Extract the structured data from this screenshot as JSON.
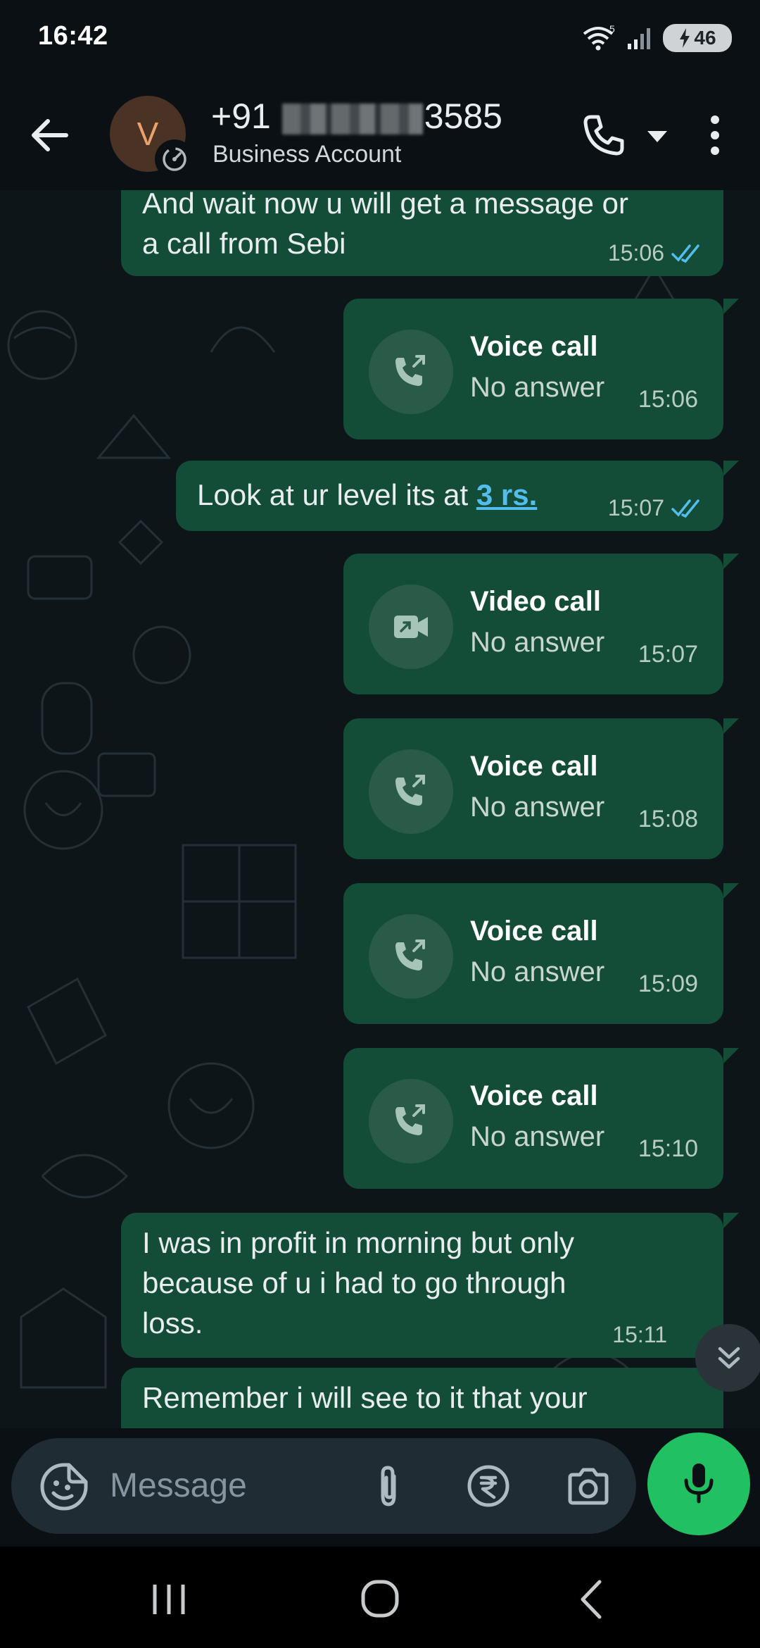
{
  "status_bar": {
    "time": "16:42",
    "wifi_badge": "5",
    "battery": "46",
    "icons": [
      "wifi-icon",
      "signal-icon",
      "battery-icon",
      "charging-bolt-icon"
    ]
  },
  "header": {
    "avatar_letter": "V",
    "name_prefix": "+91",
    "name_suffix": "3585",
    "subtitle": "Business Account",
    "icons": [
      "back-arrow-icon",
      "timer-badge-icon",
      "phone-icon",
      "caret-down-icon",
      "more-vertical-icon"
    ]
  },
  "messages": [
    {
      "type": "text",
      "text_line1": "And wait now u will get a message or",
      "text_line2": "a call from Sebi",
      "time": "15:06",
      "read": true
    },
    {
      "type": "call",
      "title": "Voice call",
      "status": "No answer",
      "time": "15:06"
    },
    {
      "type": "text",
      "text": "Look at ur level its at ",
      "link": "3 rs.",
      "time": "15:07",
      "read": true
    },
    {
      "type": "call",
      "title": "Video call",
      "status": "No answer",
      "time": "15:07"
    },
    {
      "type": "call",
      "title": "Voice call",
      "status": "No answer",
      "time": "15:08"
    },
    {
      "type": "call",
      "title": "Voice call",
      "status": "No answer",
      "time": "15:09"
    },
    {
      "type": "call",
      "title": "Voice call",
      "status": "No answer",
      "time": "15:10"
    },
    {
      "type": "text",
      "text_line1": "I was in profit in morning but only",
      "text_line2": "because of u i had to go through",
      "text_line3": "loss.",
      "time": "15:11"
    },
    {
      "type": "text",
      "text_line1": "Remember i will see to it that your"
    }
  ],
  "composer": {
    "placeholder": "Message",
    "icons": [
      "emoji-sticker-icon",
      "attach-icon",
      "rupee-payment-icon",
      "camera-icon",
      "mic-icon"
    ]
  },
  "colors": {
    "outgoing_bubble": "#144d37",
    "accent_green": "#21c063",
    "read_ticks": "#53bdeb",
    "background": "#0b1014"
  }
}
